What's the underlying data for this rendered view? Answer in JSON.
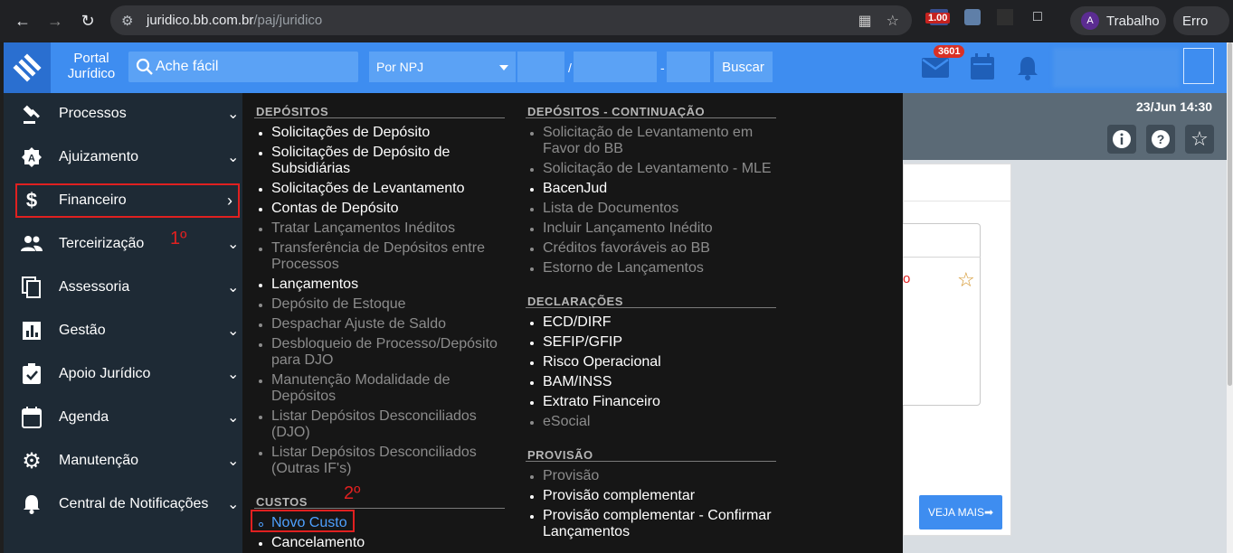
{
  "browser": {
    "url_host": "juridico.bb.com.br",
    "url_path": "/paj/juridico",
    "extension_badge": "1.00",
    "profile_initial": "A",
    "profile_name": "Trabalho",
    "error_label": "Erro"
  },
  "header": {
    "portal_line1": "Portal",
    "portal_line2": "Jurídico",
    "search_placeholder": "Ache fácil",
    "npj_select": "Por NPJ",
    "sep1": "/",
    "sep2": "-",
    "buscar": "Buscar",
    "notif_count": "3601"
  },
  "sidebar": {
    "items": [
      {
        "label": "Processos",
        "icon": "gavel-icon"
      },
      {
        "label": "Ajuizamento",
        "icon": "badge-a-icon"
      },
      {
        "label": "Financeiro",
        "icon": "dollar-icon"
      },
      {
        "label": "Terceirização",
        "icon": "people-icon"
      },
      {
        "label": "Assessoria",
        "icon": "copy-icon"
      },
      {
        "label": "Gestão",
        "icon": "bar-chart-icon"
      },
      {
        "label": "Apoio Jurídico",
        "icon": "clipboard-check-icon"
      },
      {
        "label": "Agenda",
        "icon": "calendar-icon"
      },
      {
        "label": "Manutenção",
        "icon": "gear-icon"
      },
      {
        "label": "Central de Notificações",
        "icon": "bell-icon"
      }
    ]
  },
  "annotations": {
    "first": "1º",
    "second": "2º"
  },
  "menu": {
    "depositos_title": "DEPÓSITOS",
    "depositos": [
      {
        "t": "Solicitações de Depósito",
        "s": "active"
      },
      {
        "t": "Solicitações de Depósito de Subsidiárias",
        "s": "active"
      },
      {
        "t": "Solicitações de Levantamento",
        "s": "active"
      },
      {
        "t": "Contas de Depósito",
        "s": "active"
      },
      {
        "t": "Tratar Lançamentos Inéditos",
        "s": "dim"
      },
      {
        "t": "Transferência de Depósitos entre Processos",
        "s": "dim"
      },
      {
        "t": "Lançamentos",
        "s": "active"
      },
      {
        "t": "Depósito de Estoque",
        "s": "dim"
      },
      {
        "t": "Despachar Ajuste de Saldo",
        "s": "dim"
      },
      {
        "t": "Desbloqueio de Processo/Depósito para DJO",
        "s": "dim"
      },
      {
        "t": "Manutenção Modalidade de Depósitos",
        "s": "dim"
      },
      {
        "t": "Listar Depósitos Desconciliados (DJO)",
        "s": "dim"
      },
      {
        "t": "Listar Depósitos Desconciliados (Outras IF's)",
        "s": "dim"
      }
    ],
    "custos_title": "CUSTOS",
    "custos": [
      {
        "t": "Novo Custo",
        "s": "link"
      },
      {
        "t": "Cancelamento",
        "s": "active"
      }
    ],
    "cont_title": "DEPÓSITOS - CONTINUAÇÃO",
    "cont": [
      {
        "t": "Solicitação de Levantamento em Favor do BB",
        "s": "dim"
      },
      {
        "t": "Solicitação de Levantamento - MLE",
        "s": "dim"
      },
      {
        "t": "BacenJud",
        "s": "active"
      },
      {
        "t": "Lista de Documentos",
        "s": "dim"
      },
      {
        "t": "Incluir Lançamento Inédito",
        "s": "dim"
      },
      {
        "t": "Créditos favoráveis ao BB",
        "s": "dim"
      },
      {
        "t": "Estorno de Lançamentos",
        "s": "dim"
      }
    ],
    "decl_title": "DECLARAÇÕES",
    "decl": [
      {
        "t": "ECD/DIRF",
        "s": "active"
      },
      {
        "t": "SEFIP/GFIP",
        "s": "active"
      },
      {
        "t": "Risco Operacional",
        "s": "active"
      },
      {
        "t": "BAM/INSS",
        "s": "active"
      },
      {
        "t": "Extrato Financeiro",
        "s": "active"
      },
      {
        "t": "eSocial",
        "s": "dim"
      }
    ],
    "prov_title": "PROVISÃO",
    "prov": [
      {
        "t": "Provisão",
        "s": "dim"
      },
      {
        "t": "Provisão complementar",
        "s": "active"
      },
      {
        "t": "Provisão complementar - Confirmar Lançamentos",
        "s": "active"
      }
    ]
  },
  "page": {
    "datetime": "23/Jun 14:30",
    "red_fragment": "o",
    "veja_mais": "VEJA MAIS➡"
  }
}
